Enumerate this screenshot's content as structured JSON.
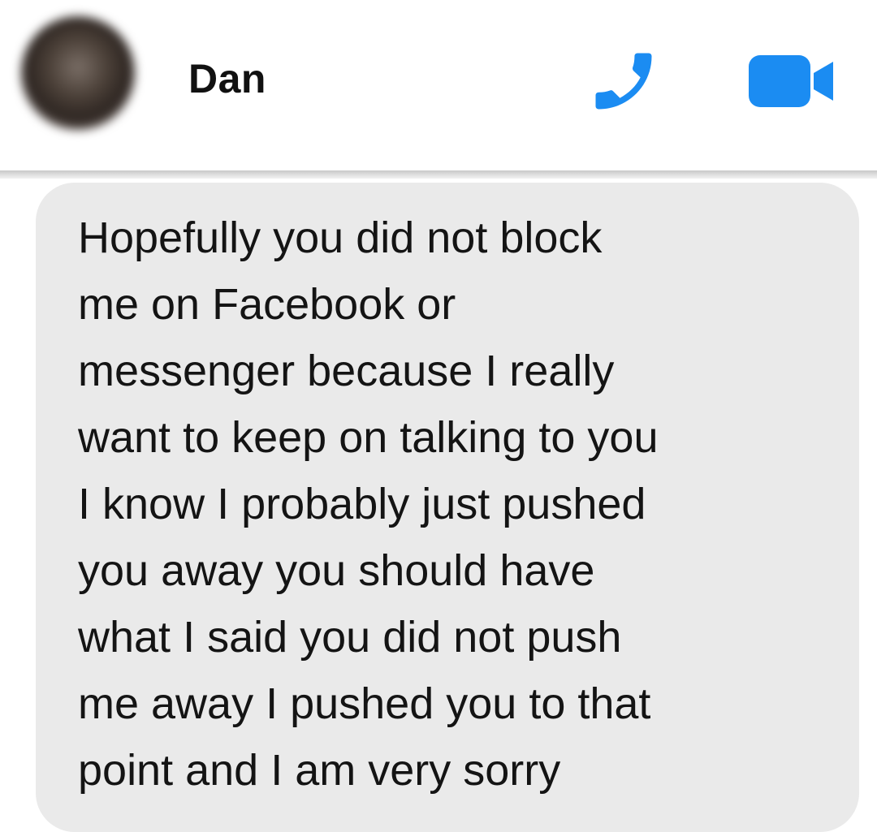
{
  "header": {
    "contact_name": "Dan",
    "avatar_icon": "avatar-blurred",
    "call_icon": "phone-icon",
    "video_icon": "video-camera-icon",
    "accent_color": "#1b8cf2"
  },
  "message": {
    "text": "Hopefully you did not block\nme on Facebook or\nmessenger because I really\nwant to keep on talking to you\nI know I probably just pushed\nyou away you should have\nwhat I said you did not push\nme away I pushed you to that\npoint and I am very sorry",
    "bubble_color": "#eaeaea"
  }
}
